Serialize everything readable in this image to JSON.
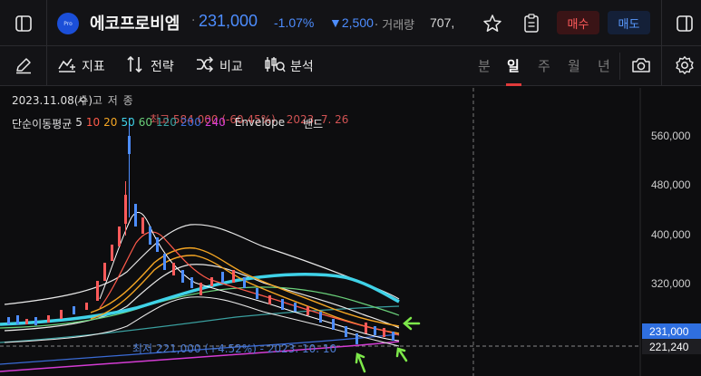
{
  "header": {
    "stock_name": "에코프로비엠",
    "logo_text": "Pro",
    "price": "231,000",
    "change_pct": "-1.07%",
    "change_abs": "▼2,500",
    "volume_label": "· 거래량",
    "volume_value": "707,",
    "buy_label": "매수",
    "sell_label": "매도"
  },
  "toolbar": {
    "indicator_label": "지표",
    "strategy_label": "전략",
    "compare_label": "비교",
    "analysis_label": "분석",
    "periods": [
      "분",
      "일",
      "주",
      "월",
      "년"
    ],
    "active_period": "일"
  },
  "chart_info": {
    "date": "2023.11.08(수)",
    "ohlc_labels": "시 고 저 종",
    "ma_label": "단순이동평균",
    "ma_periods": [
      "5",
      "10",
      "20",
      "50",
      "60",
      "120",
      "200",
      "240"
    ],
    "envelope_label": "Envelope",
    "band_label": "밴드",
    "high_note": "최고 584,000 (-60.45%) - 2023. 7. 26",
    "low_note": "최저 221,000 (+4.52%) - 2023. 10. 10"
  },
  "axis": {
    "ticks": [
      "560,000",
      "480,000",
      "400,000",
      "320,000"
    ],
    "current_price_tag": "231,000",
    "crosshair_price_tag": "221,240"
  },
  "colors": {
    "down_blue": "#4d8dff",
    "up_red": "#ff5a5a",
    "ma5": "#ffffff",
    "ma10": "#ff5a4a",
    "ma20": "#f5a623",
    "ma50": "#3fd2e8",
    "ma60": "#6ad07a",
    "ma120": "#3aa0a0",
    "ma200": "#3a6bd6",
    "ma240": "#d43cd4",
    "annotation_arrow": "#7de84a"
  },
  "icons": [
    "sidebar-toggle-icon",
    "star-icon",
    "clipboard-icon",
    "layout-icon",
    "pencil-icon",
    "indicator-icon",
    "strategy-icon",
    "compare-icon",
    "analysis-icon",
    "camera-icon",
    "settings-icon"
  ]
}
